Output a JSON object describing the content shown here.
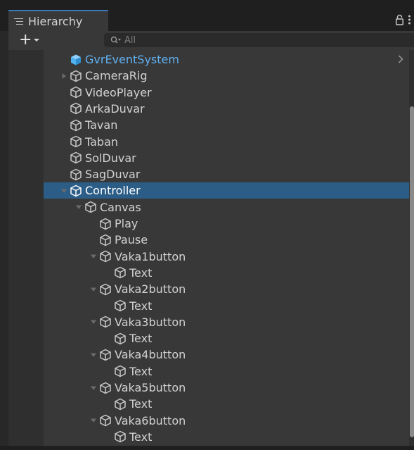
{
  "tab": {
    "title": "Hierarchy"
  },
  "toolbar": {
    "add_label": "+",
    "search_placeholder": "All"
  },
  "hierarchy": [
    {
      "name": "GvrEventSystem",
      "depth": 1,
      "expander": "none",
      "kind": "prefab",
      "has_child_chevron": true
    },
    {
      "name": "CameraRig",
      "depth": 1,
      "expander": "collapsed",
      "kind": "object"
    },
    {
      "name": "VideoPlayer",
      "depth": 1,
      "expander": "none",
      "kind": "object"
    },
    {
      "name": "ArkaDuvar",
      "depth": 1,
      "expander": "none",
      "kind": "object"
    },
    {
      "name": "Tavan",
      "depth": 1,
      "expander": "none",
      "kind": "object"
    },
    {
      "name": "Taban",
      "depth": 1,
      "expander": "none",
      "kind": "object"
    },
    {
      "name": "SolDuvar",
      "depth": 1,
      "expander": "none",
      "kind": "object"
    },
    {
      "name": "SagDuvar",
      "depth": 1,
      "expander": "none",
      "kind": "object"
    },
    {
      "name": "Controller",
      "depth": 1,
      "expander": "expanded",
      "kind": "object",
      "selected": true
    },
    {
      "name": "Canvas",
      "depth": 2,
      "expander": "expanded",
      "kind": "object"
    },
    {
      "name": "Play",
      "depth": 3,
      "expander": "none",
      "kind": "object"
    },
    {
      "name": "Pause",
      "depth": 3,
      "expander": "none",
      "kind": "object"
    },
    {
      "name": "Vaka1button",
      "depth": 3,
      "expander": "expanded",
      "kind": "object"
    },
    {
      "name": "Text",
      "depth": 4,
      "expander": "none",
      "kind": "object"
    },
    {
      "name": "Vaka2button",
      "depth": 3,
      "expander": "expanded",
      "kind": "object"
    },
    {
      "name": "Text",
      "depth": 4,
      "expander": "none",
      "kind": "object"
    },
    {
      "name": "Vaka3button",
      "depth": 3,
      "expander": "expanded",
      "kind": "object"
    },
    {
      "name": "Text",
      "depth": 4,
      "expander": "none",
      "kind": "object"
    },
    {
      "name": "Vaka4button",
      "depth": 3,
      "expander": "expanded",
      "kind": "object"
    },
    {
      "name": "Text",
      "depth": 4,
      "expander": "none",
      "kind": "object"
    },
    {
      "name": "Vaka5button",
      "depth": 3,
      "expander": "expanded",
      "kind": "object"
    },
    {
      "name": "Text",
      "depth": 4,
      "expander": "none",
      "kind": "object"
    },
    {
      "name": "Vaka6button",
      "depth": 3,
      "expander": "expanded",
      "kind": "object"
    },
    {
      "name": "Text",
      "depth": 4,
      "expander": "none",
      "kind": "object"
    }
  ],
  "colors": {
    "selection": "#2c5d87",
    "prefab_text": "#5fb0f1",
    "prefab_icon": "#4fb3f0",
    "tab_accent": "#3a79bb"
  }
}
